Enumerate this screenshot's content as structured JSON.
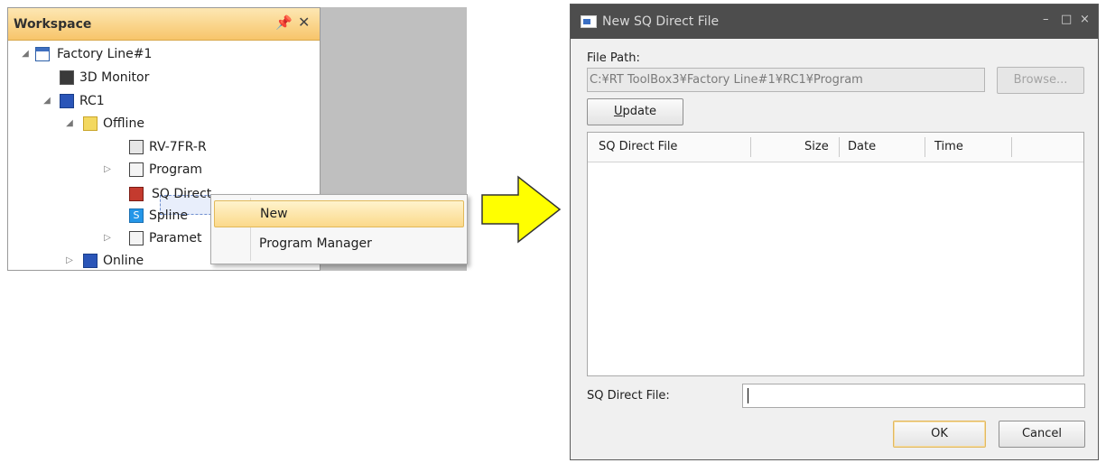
{
  "workspace": {
    "title": "Workspace",
    "pin_icon": "pin-icon",
    "close_icon": "close-icon",
    "tree": {
      "factory": "Factory Line#1",
      "monitor": "3D Monitor",
      "robot": "RC1",
      "offline": "Offline",
      "rv": "RV-7FR-R",
      "program": "Program",
      "sqdirect": "SQ Direct",
      "spline": "Spline",
      "parameter": "Paramet",
      "online": "Online"
    }
  },
  "context_menu": {
    "items": [
      "New",
      "Program Manager"
    ]
  },
  "dialog": {
    "title": "New SQ Direct File",
    "file_path_label": "File Path:",
    "file_path_value": "C:¥RT ToolBox3¥Factory Line#1¥RC1¥Program",
    "browse_label": "Browse...",
    "update_label": "Update",
    "columns": [
      "SQ Direct File",
      "Size",
      "Date",
      "Time"
    ],
    "rows": [],
    "name_label": "SQ Direct File:",
    "name_value": "",
    "ok_label": "OK",
    "cancel_label": "Cancel",
    "minimize_glyph": "–",
    "maximize_glyph": "□",
    "close_glyph": "×"
  },
  "colors": {
    "workspace_header": "#f7c56a",
    "dialog_titlebar": "#4d4d4d",
    "menu_highlight": "#fbd98a",
    "arrow_fill": "#ffff00"
  }
}
